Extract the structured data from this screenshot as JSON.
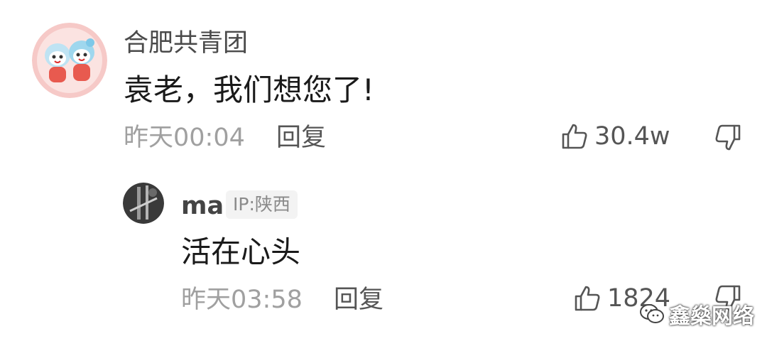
{
  "comment": {
    "username": "合肥共青团",
    "avatar": "cartoon-mascots-avatar",
    "text": "袁老，我们想您了!",
    "time": "昨天00:04",
    "reply_label": "回复",
    "like_count": "30.4w",
    "like_icon": "thumbs-up-icon",
    "dislike_icon": "thumbs-down-icon"
  },
  "reply": {
    "username": "ma",
    "avatar": "photo-avatar",
    "ip_label": "IP:陕西",
    "text": "活在心头",
    "time": "昨天03:58",
    "reply_label": "回复",
    "like_count": "1824",
    "like_icon": "thumbs-up-icon",
    "dislike_icon": "thumbs-down-icon"
  },
  "watermark": {
    "text": "鑫燊网络",
    "icon": "wechat-icon"
  },
  "colors": {
    "background": "#ffffff",
    "text_primary": "#1a1a1a",
    "text_secondary": "#a0a0a0",
    "username": "#4a4a4a",
    "badge_bg": "#f3f3f3"
  }
}
